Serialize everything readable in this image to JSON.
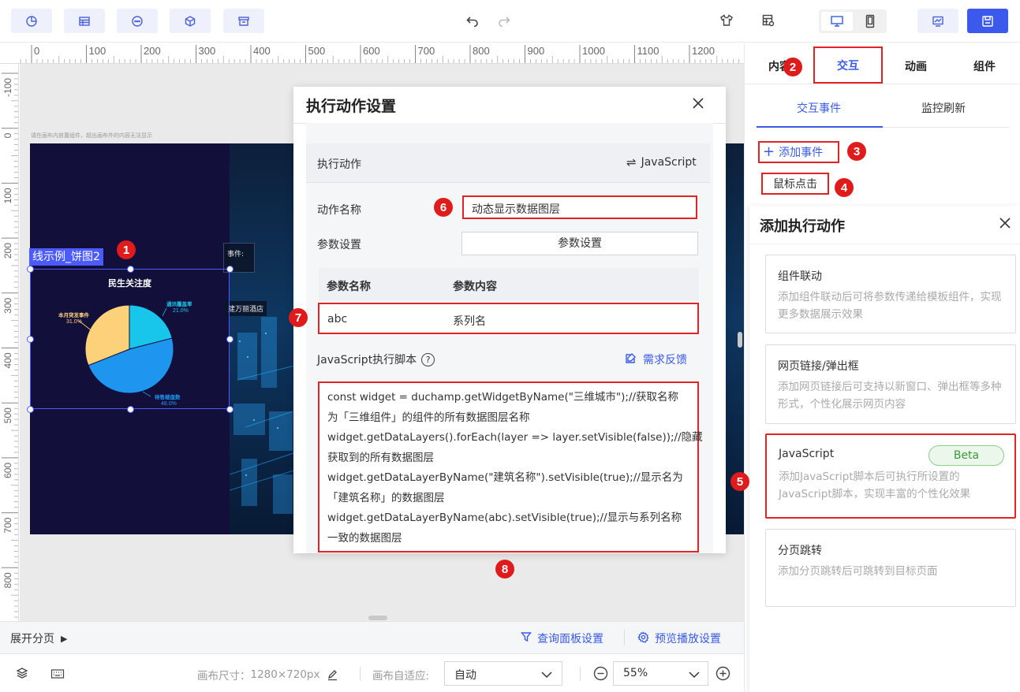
{
  "toolbar": {
    "left_icons": [
      "chart-pie-icon",
      "table-icon",
      "ellipsis-circle-icon",
      "cube-icon",
      "archive-icon"
    ],
    "undo": "undo-icon",
    "redo": "redo-icon",
    "right_icons": [
      "shirt-icon",
      "grid-settings-icon",
      "desktop-icon",
      "mobile-icon",
      "preview-chart-icon",
      "save-icon"
    ]
  },
  "ruler": {
    "top_ticks": [
      "0",
      "100",
      "200",
      "300",
      "400",
      "500",
      "600",
      "700",
      "800",
      "900",
      "1000",
      "1100",
      "1200",
      "1"
    ],
    "left_ticks": [
      "-100",
      "0",
      "100",
      "200",
      "300",
      "400",
      "500",
      "600",
      "700",
      "800"
    ]
  },
  "canvas": {
    "hint": "请在画布内放置组件，超出画布外的内容无法显示",
    "widget_label": "线示例_饼图2",
    "chart_title": "民生关注度",
    "bg_text_1": "事件:",
    "bg_text_2": "建万丽酒店"
  },
  "chart_data": {
    "type": "pie",
    "title": "民生关注度",
    "categories": [
      "通讯覆盖率",
      "待售楼盘数",
      "本月突发事件"
    ],
    "values": [
      21.0,
      48.0,
      31.0
    ],
    "value_labels": [
      "21.0%",
      "48.0%",
      "31.0%"
    ],
    "colors": [
      "#17c6ea",
      "#1e96f0",
      "#fdd07a"
    ]
  },
  "dialog": {
    "title": "执行动作设置",
    "action_label": "执行动作",
    "action_type": "JavaScript",
    "name_label": "动作名称",
    "name_value": "动态显示数据图层",
    "param_label": "参数设置",
    "param_button": "参数设置",
    "table_headers": [
      "参数名称",
      "参数内容"
    ],
    "table_rows": [
      [
        "abc",
        "系列名"
      ]
    ],
    "script_label": "JavaScript执行脚本",
    "feedback": "需求反馈",
    "script_lines": [
      "const widget = duchamp.getWidgetByName(\"三维城市\");//获取名称",
      "为「三维组件」的组件的所有数据图层名称",
      "widget.getDataLayers().forEach(layer => layer.setVisible(false));//隐藏",
      "获取到的所有数据图层",
      "widget.getDataLayerByName(\"建筑名称\").setVisible(true);//显示名为",
      "「建筑名称」的数据图层",
      "widget.getDataLayerByName(abc).setVisible(true);//显示与系列名称",
      "一致的数据图层"
    ]
  },
  "right_panel": {
    "tabs": [
      "内容",
      "交互",
      "动画",
      "组件"
    ],
    "subtabs": [
      "交互事件",
      "监控刷新"
    ],
    "add_event": "添加事件",
    "event_item": "鼠标点击",
    "add_action_title": "添加执行动作",
    "cards": [
      {
        "title": "组件联动",
        "desc": "添加组件联动后可将参数传递给模板组件，实现更多数据展示效果"
      },
      {
        "title": "网页链接/弹出框",
        "desc": "添加网页链接后可支持以新窗口、弹出框等多种形式，个性化展示网页内容"
      },
      {
        "title": "JavaScript",
        "desc": "添加JavaScript脚本后可执行所设置的JavaScript脚本，实现丰富的个性化效果",
        "tag": "Beta"
      },
      {
        "title": "分页跳转",
        "desc": "添加分页跳转后可跳转到目标页面"
      }
    ]
  },
  "bottom": {
    "expand_pages": "展开分页",
    "query_panel": "查询面板设置",
    "preview_settings": "预览播放设置",
    "canvas_size_label": "画布尺寸：",
    "canvas_size": "1280×720px",
    "adapt_label": "画布自适应:",
    "adapt_value": "自动",
    "zoom_value": "55%"
  },
  "badges": [
    "1",
    "2",
    "3",
    "4",
    "5",
    "6",
    "7",
    "8"
  ]
}
